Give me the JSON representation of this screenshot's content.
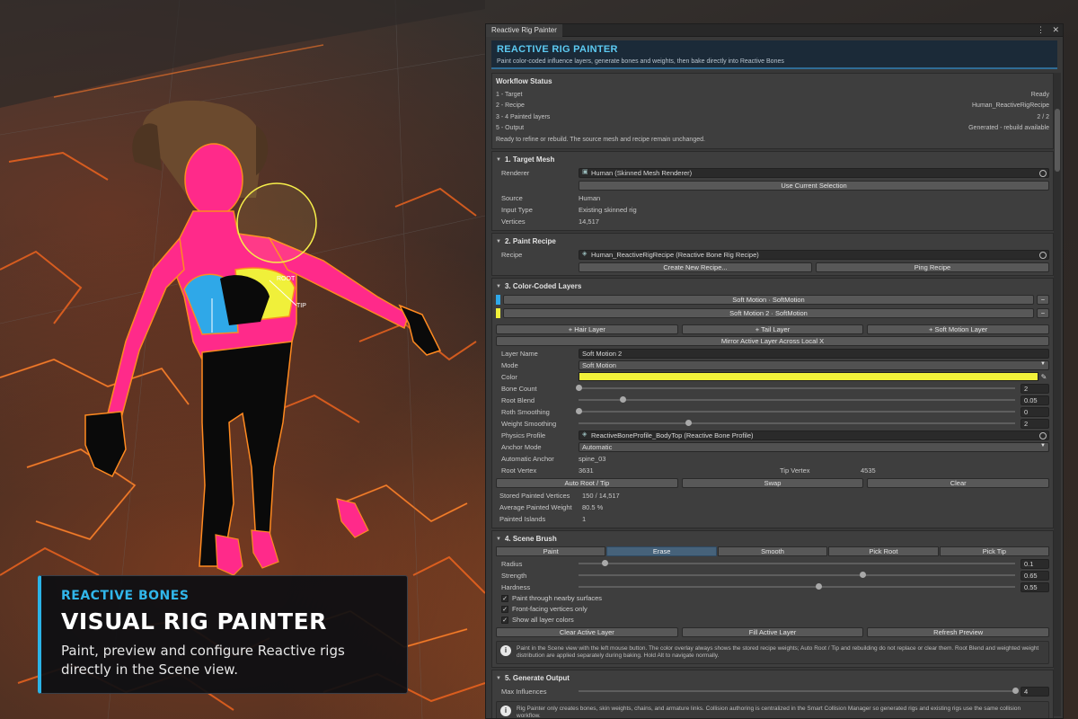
{
  "window": {
    "tab_label": "Reactive Rig Painter",
    "banner_title": "REACTIVE RIG PAINTER",
    "banner_subtitle": "Paint color-coded influence layers, generate bones and weights, then bake directly into Reactive Bones"
  },
  "workflow": {
    "title": "Workflow Status",
    "rows": [
      {
        "label": "1 - Target",
        "value": "Ready"
      },
      {
        "label": "2 - Recipe",
        "value": "Human_ReactiveRigRecipe"
      },
      {
        "label": "3 - 4 Painted layers",
        "value": "2 / 2"
      },
      {
        "label": "5 - Output",
        "value": "Generated - rebuild available"
      }
    ],
    "note": "Ready to refine or rebuild. The source mesh and recipe remain unchanged."
  },
  "target_mesh": {
    "header": "1. Target Mesh",
    "renderer_label": "Renderer",
    "renderer_value": "Human (Skinned Mesh Renderer)",
    "use_selection_button": "Use Current Selection",
    "source_label": "Source",
    "source_value": "Human",
    "input_type_label": "Input Type",
    "input_type_value": "Existing skinned rig",
    "vertices_label": "Vertices",
    "vertices_value": "14,517"
  },
  "paint_recipe": {
    "header": "2. Paint Recipe",
    "recipe_label": "Recipe",
    "recipe_value": "Human_ReactiveRigRecipe (Reactive Bone Rig Recipe)",
    "create_button": "Create New Recipe...",
    "ping_button": "Ping Recipe"
  },
  "layers": {
    "header": "3. Color-Coded Layers",
    "items": [
      {
        "label": "Soft Motion  · SoftMotion",
        "color": "#2fa8e8"
      },
      {
        "label": "Soft Motion 2  · SoftMotion",
        "color": "#f0f03a"
      }
    ],
    "minus_glyph": "−",
    "add_hair": "+ Hair Layer",
    "add_tail": "+ Tail Layer",
    "add_soft": "+ Soft Motion Layer",
    "mirror_button": "Mirror Active Layer Across Local X",
    "layer_name_label": "Layer Name",
    "layer_name_value": "Soft Motion 2",
    "mode_label": "Mode",
    "mode_value": "Soft Motion",
    "color_label": "Color",
    "color_value": "#f2f23a",
    "bone_count_label": "Bone Count",
    "bone_count_value": "2",
    "bone_count_fraction": 0.0,
    "root_blend_label": "Root Blend",
    "root_blend_value": "0.05",
    "root_blend_fraction": 0.1,
    "roth_smoothing_label": "Roth Smoothing",
    "roth_smoothing_value": "0",
    "roth_smoothing_fraction": 0.0,
    "weight_smoothing_label": "Weight Smoothing",
    "weight_smoothing_value": "2",
    "weight_smoothing_fraction": 0.25,
    "physics_profile_label": "Physics Profile",
    "physics_profile_value": "ReactiveBoneProfile_BodyTop (Reactive Bone Profile)",
    "anchor_mode_label": "Anchor Mode",
    "anchor_mode_value": "Automatic",
    "automatic_anchor_label": "Automatic Anchor",
    "automatic_anchor_value": "spine_03",
    "root_vertex_label": "Root Vertex",
    "root_vertex_value": "3631",
    "tip_vertex_label": "Tip Vertex",
    "tip_vertex_value": "4535",
    "auto_root_button": "Auto Root / Tip",
    "swap_button": "Swap",
    "clear_button": "Clear",
    "stored_label": "Stored Painted Vertices",
    "stored_value": "150 / 14,517",
    "avg_label": "Average Painted Weight",
    "avg_value": "80.5 %",
    "islands_label": "Painted Islands",
    "islands_value": "1"
  },
  "scene_brush": {
    "header": "4. Scene Brush",
    "tabs": [
      "Paint",
      "Erase",
      "Smooth",
      "Pick Root",
      "Pick Tip"
    ],
    "active_tab": "Erase",
    "radius_label": "Radius",
    "radius_value": "0.1",
    "radius_fraction": 0.06,
    "strength_label": "Strength",
    "strength_value": "0.65",
    "strength_fraction": 0.65,
    "hardness_label": "Hardness",
    "hardness_value": "0.55",
    "hardness_fraction": 0.55,
    "checkboxes": [
      {
        "label": "Paint through nearby surfaces",
        "checked": true
      },
      {
        "label": "Front-facing vertices only",
        "checked": true
      },
      {
        "label": "Show all layer colors",
        "checked": true
      }
    ],
    "clear_active": "Clear Active Layer",
    "fill_active": "Fill Active Layer",
    "refresh_preview": "Refresh Preview",
    "help_text": "Paint in the Scene view with the left mouse button. The color overlay always shows the stored recipe weights; Auto Root / Tip and rebuilding do not replace or clear them. Root Blend and weighted weight distribution are applied separately during baking. Hold Alt to navigate normally."
  },
  "generate_output": {
    "header": "5. Generate Output",
    "max_influences_label": "Max Influences",
    "max_influences_value": "4",
    "max_influences_fraction": 1.0,
    "help_text": "Rig Painter only creates bones, skin weights, chains, and armature links. Collision authoring is centralized in the Smart Collision Manager so generated rigs and existing rigs use the same collision workflow."
  },
  "promo": {
    "kicker": "REACTIVE BONES",
    "headline": "VISUAL RIG PAINTER",
    "description_line1": "Paint, preview and configure Reactive rigs",
    "description_line2": "directly in the Scene view."
  },
  "viewport": {
    "gizmo_labels": [
      "ROOT",
      "TIP"
    ]
  }
}
